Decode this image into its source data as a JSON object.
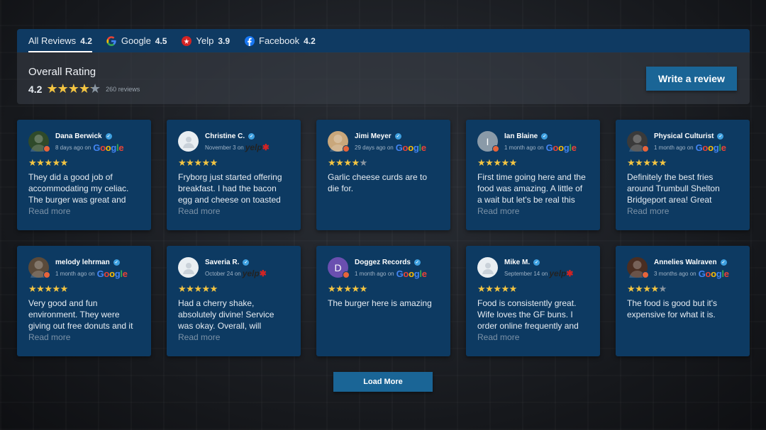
{
  "tabs": [
    {
      "label": "All Reviews",
      "score": "4.2",
      "icon": "all-icon"
    },
    {
      "label": "Google",
      "score": "4.5",
      "icon": "google-icon"
    },
    {
      "label": "Yelp",
      "score": "3.9",
      "icon": "yelp-icon"
    },
    {
      "label": "Facebook",
      "score": "4.2",
      "icon": "facebook-icon"
    }
  ],
  "overall": {
    "title": "Overall Rating",
    "score": "4.2",
    "stars": 4.2,
    "count": "260 reviews"
  },
  "write_review_label": "Write a review",
  "load_more_label": "Load More",
  "read_more_label": "Read more",
  "colors": {
    "card_bg": "#0d3a62",
    "tab_bar_bg": "#0f3a62",
    "button_bg": "#1a6596",
    "star": "#f4c542",
    "star_empty": "#8a96a2"
  },
  "reviews": [
    {
      "name": "Dana Berwick",
      "date": "8 days ago on",
      "source": "Google",
      "stars": 5,
      "text": "They did a good job of accommodating my celiac. The burger was great and",
      "read_more": true,
      "avatar_color": "#2f4a2a",
      "avatar_letter": ""
    },
    {
      "name": "Christine C.",
      "date": "November 3 on",
      "source": "Yelp",
      "stars": 5,
      "text": "Fryborg just started offering breakfast. I had the bacon egg and cheese on toasted",
      "read_more": true,
      "avatar_color": "#e9eef2",
      "avatar_letter": ""
    },
    {
      "name": "Jimi Meyer",
      "date": "29 days ago on",
      "source": "Google",
      "stars": 4,
      "text": "Garlic cheese curds are to die for.",
      "read_more": false,
      "avatar_color": "#c9a77b",
      "avatar_letter": ""
    },
    {
      "name": "Ian Blaine",
      "date": "1 month ago on",
      "source": "Google",
      "stars": 5,
      "text": "First time going here and the food was amazing. A little of a wait but let's be real this",
      "read_more": true,
      "avatar_color": "#8a9aa8",
      "avatar_letter": "I"
    },
    {
      "name": "Physical Culturist",
      "date": "1 month ago on",
      "source": "Google",
      "stars": 5,
      "text": "Definitely the best fries around Trumbull Shelton Bridgeport area! Great",
      "read_more": true,
      "avatar_color": "#3a3a3a",
      "avatar_letter": ""
    },
    {
      "name": "melody lehrman",
      "date": "1 month ago on",
      "source": "Google",
      "stars": 5,
      "text": "Very good and fun environment. They were giving out free donuts and it",
      "read_more": true,
      "avatar_color": "#5a4a3a",
      "avatar_letter": ""
    },
    {
      "name": "Saveria R.",
      "date": "October 24 on",
      "source": "Yelp",
      "stars": 5,
      "text": "Had a cherry shake, absolutely divine! Service was okay. Overall, will",
      "read_more": true,
      "avatar_color": "#e9eef2",
      "avatar_letter": ""
    },
    {
      "name": "Doggez Records",
      "date": "1 month ago on",
      "source": "Google",
      "stars": 5,
      "text": "The burger here is amazing",
      "read_more": false,
      "avatar_color": "#6a4fb0",
      "avatar_letter": "D"
    },
    {
      "name": "Mike M.",
      "date": "September 14 on",
      "source": "Yelp",
      "stars": 5,
      "text": "Food is consistently great. Wife loves the GF buns. I order online frequently and",
      "read_more": true,
      "avatar_color": "#e9eef2",
      "avatar_letter": ""
    },
    {
      "name": "Annelies Walraven",
      "date": "3 months ago on",
      "source": "Google",
      "stars": 4,
      "text": "The food is good but it's expensive for what it is.",
      "read_more": false,
      "avatar_color": "#4a2e22",
      "avatar_letter": ""
    }
  ]
}
